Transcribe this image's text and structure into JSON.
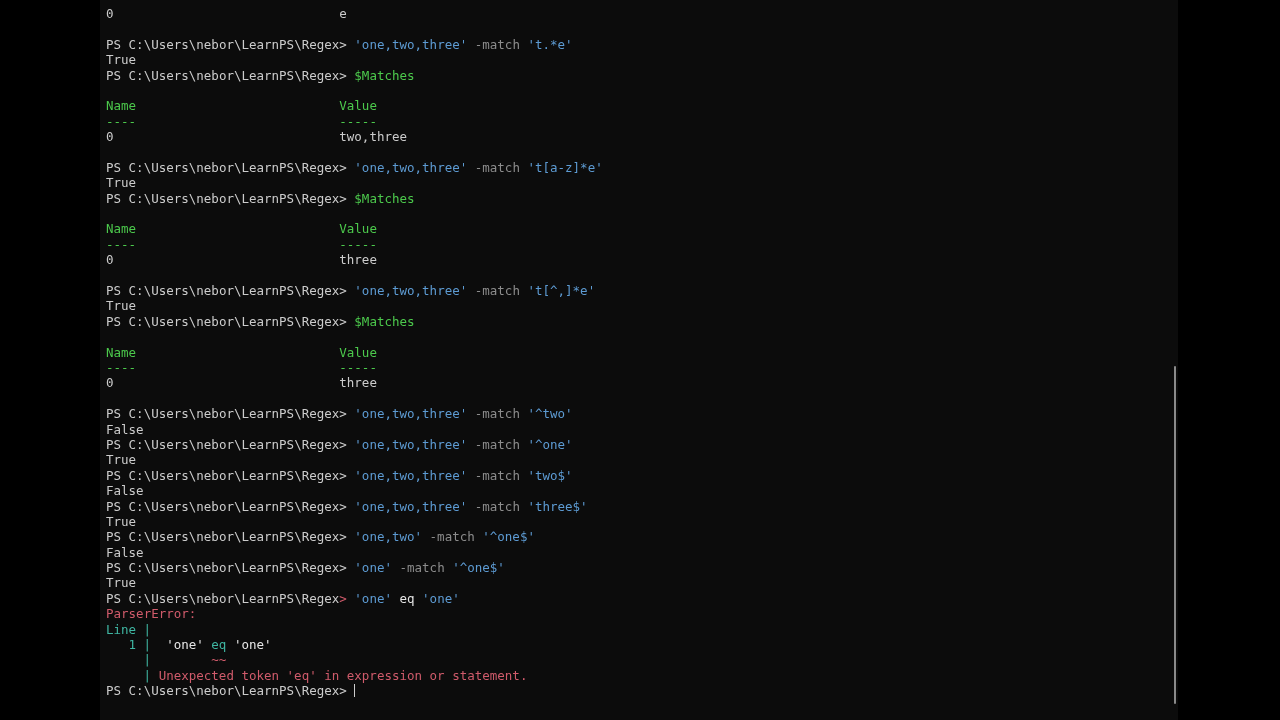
{
  "terminal": {
    "lines": [
      {
        "kind": "table",
        "rows": [
          [
            "0",
            "e"
          ]
        ]
      },
      {
        "kind": "blank"
      },
      {
        "kind": "prompt",
        "path": "PS C:\\Users\\nebor\\LearnPS\\Regex",
        "marker": ">",
        "invalid": false,
        "tokens": [
          {
            "kind": "string",
            "text": "'one,two,three'"
          },
          {
            "kind": "parameter",
            "text": "-match"
          },
          {
            "kind": "string",
            "text": "'t.*e'"
          }
        ]
      },
      {
        "kind": "output",
        "text": "True"
      },
      {
        "kind": "prompt",
        "path": "PS C:\\Users\\nebor\\LearnPS\\Regex",
        "marker": ">",
        "invalid": false,
        "tokens": [
          {
            "kind": "variable",
            "text": "$Matches"
          }
        ]
      },
      {
        "kind": "blank"
      },
      {
        "kind": "table",
        "columns": [
          "Name",
          "Value"
        ],
        "rules": [
          "----",
          "-----"
        ],
        "rows": [
          [
            "0",
            "two,three"
          ]
        ]
      },
      {
        "kind": "blank"
      },
      {
        "kind": "prompt",
        "path": "PS C:\\Users\\nebor\\LearnPS\\Regex",
        "marker": ">",
        "invalid": false,
        "tokens": [
          {
            "kind": "string",
            "text": "'one,two,three'"
          },
          {
            "kind": "parameter",
            "text": "-match"
          },
          {
            "kind": "string",
            "text": "'t[a-z]*e'"
          }
        ]
      },
      {
        "kind": "output",
        "text": "True"
      },
      {
        "kind": "prompt",
        "path": "PS C:\\Users\\nebor\\LearnPS\\Regex",
        "marker": ">",
        "invalid": false,
        "tokens": [
          {
            "kind": "variable",
            "text": "$Matches"
          }
        ]
      },
      {
        "kind": "blank"
      },
      {
        "kind": "table",
        "columns": [
          "Name",
          "Value"
        ],
        "rules": [
          "----",
          "-----"
        ],
        "rows": [
          [
            "0",
            "three"
          ]
        ]
      },
      {
        "kind": "blank"
      },
      {
        "kind": "prompt",
        "path": "PS C:\\Users\\nebor\\LearnPS\\Regex",
        "marker": ">",
        "invalid": false,
        "tokens": [
          {
            "kind": "string",
            "text": "'one,two,three'"
          },
          {
            "kind": "parameter",
            "text": "-match"
          },
          {
            "kind": "string",
            "text": "'t[^,]*e'"
          }
        ]
      },
      {
        "kind": "output",
        "text": "True"
      },
      {
        "kind": "prompt",
        "path": "PS C:\\Users\\nebor\\LearnPS\\Regex",
        "marker": ">",
        "invalid": false,
        "tokens": [
          {
            "kind": "variable",
            "text": "$Matches"
          }
        ]
      },
      {
        "kind": "blank"
      },
      {
        "kind": "table",
        "columns": [
          "Name",
          "Value"
        ],
        "rules": [
          "----",
          "-----"
        ],
        "rows": [
          [
            "0",
            "three"
          ]
        ]
      },
      {
        "kind": "blank"
      },
      {
        "kind": "prompt",
        "path": "PS C:\\Users\\nebor\\LearnPS\\Regex",
        "marker": ">",
        "invalid": false,
        "tokens": [
          {
            "kind": "string",
            "text": "'one,two,three'"
          },
          {
            "kind": "parameter",
            "text": "-match"
          },
          {
            "kind": "string",
            "text": "'^two'"
          }
        ]
      },
      {
        "kind": "output",
        "text": "False"
      },
      {
        "kind": "prompt",
        "path": "PS C:\\Users\\nebor\\LearnPS\\Regex",
        "marker": ">",
        "invalid": false,
        "tokens": [
          {
            "kind": "string",
            "text": "'one,two,three'"
          },
          {
            "kind": "parameter",
            "text": "-match"
          },
          {
            "kind": "string",
            "text": "'^one'"
          }
        ]
      },
      {
        "kind": "output",
        "text": "True"
      },
      {
        "kind": "prompt",
        "path": "PS C:\\Users\\nebor\\LearnPS\\Regex",
        "marker": ">",
        "invalid": false,
        "tokens": [
          {
            "kind": "string",
            "text": "'one,two,three'"
          },
          {
            "kind": "parameter",
            "text": "-match"
          },
          {
            "kind": "string",
            "text": "'two$'"
          }
        ]
      },
      {
        "kind": "output",
        "text": "False"
      },
      {
        "kind": "prompt",
        "path": "PS C:\\Users\\nebor\\LearnPS\\Regex",
        "marker": ">",
        "invalid": false,
        "tokens": [
          {
            "kind": "string",
            "text": "'one,two,three'"
          },
          {
            "kind": "parameter",
            "text": "-match"
          },
          {
            "kind": "string",
            "text": "'three$'"
          }
        ]
      },
      {
        "kind": "output",
        "text": "True"
      },
      {
        "kind": "prompt",
        "path": "PS C:\\Users\\nebor\\LearnPS\\Regex",
        "marker": ">",
        "invalid": false,
        "tokens": [
          {
            "kind": "string",
            "text": "'one,two'"
          },
          {
            "kind": "parameter",
            "text": "-match"
          },
          {
            "kind": "string",
            "text": "'^one$'"
          }
        ]
      },
      {
        "kind": "output",
        "text": "False"
      },
      {
        "kind": "prompt",
        "path": "PS C:\\Users\\nebor\\LearnPS\\Regex",
        "marker": ">",
        "invalid": false,
        "tokens": [
          {
            "kind": "string",
            "text": "'one'"
          },
          {
            "kind": "parameter",
            "text": "-match"
          },
          {
            "kind": "string",
            "text": "'^one$'"
          }
        ]
      },
      {
        "kind": "output",
        "text": "True"
      },
      {
        "kind": "prompt",
        "path": "PS C:\\Users\\nebor\\LearnPS\\Regex",
        "marker": ">",
        "invalid": true,
        "tokens": [
          {
            "kind": "string",
            "text": "'one'"
          },
          {
            "kind": "plain",
            "text": "eq"
          },
          {
            "kind": "string",
            "text": "'one'"
          }
        ]
      },
      {
        "kind": "error",
        "title": "ParserError:",
        "rows": [
          {
            "label": "Line",
            "bar": "|"
          },
          {
            "label": "1",
            "bar": "|",
            "source": [
              {
                "text": "'one'",
                "flagged": false
              },
              {
                "text": "eq",
                "flagged": true
              },
              {
                "text": "'one'",
                "flagged": false
              }
            ]
          },
          {
            "bar": "|",
            "underline": "~~"
          },
          {
            "bar": "|",
            "message": "Unexpected token 'eq' in expression or statement."
          }
        ]
      },
      {
        "kind": "prompt",
        "path": "PS C:\\Users\\nebor\\LearnPS\\Regex",
        "marker": ">",
        "invalid": false,
        "cursor": true
      }
    ]
  }
}
